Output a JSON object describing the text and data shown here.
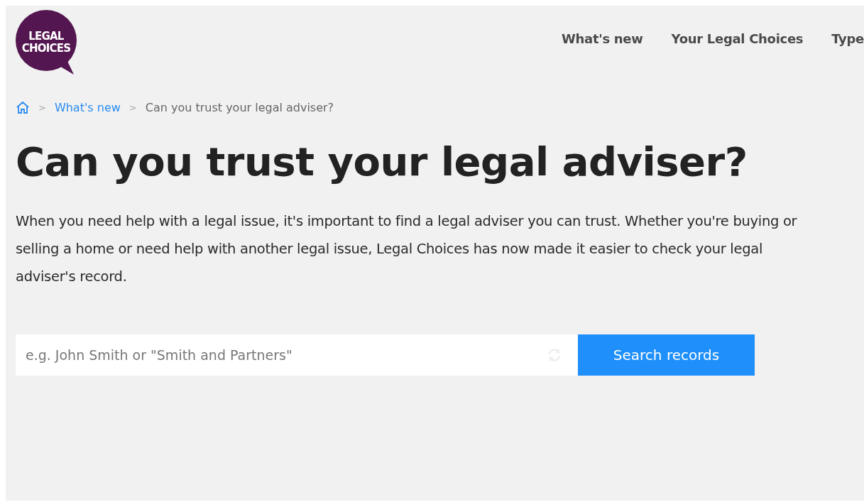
{
  "logo": {
    "lines": [
      "LEGAL",
      "CHOICES"
    ]
  },
  "nav": [
    {
      "label": "What's new"
    },
    {
      "label": "Your Legal Choices"
    },
    {
      "label": "Type"
    }
  ],
  "breadcrumb": {
    "separator": ">",
    "items": [
      {
        "kind": "home"
      },
      {
        "kind": "link",
        "label": "What's new"
      },
      {
        "kind": "current",
        "label": "Can you trust your legal adviser?"
      }
    ]
  },
  "title": "Can you trust your legal adviser?",
  "intro": "When you need help with a legal issue, it's important to find a legal adviser you can trust. Whether you're buying or selling a home or need help with another legal issue, Legal Choices has now made it easier to check your legal adviser's record.",
  "search": {
    "placeholder": "e.g. John Smith or \"Smith and Partners\"",
    "button": "Search records"
  }
}
